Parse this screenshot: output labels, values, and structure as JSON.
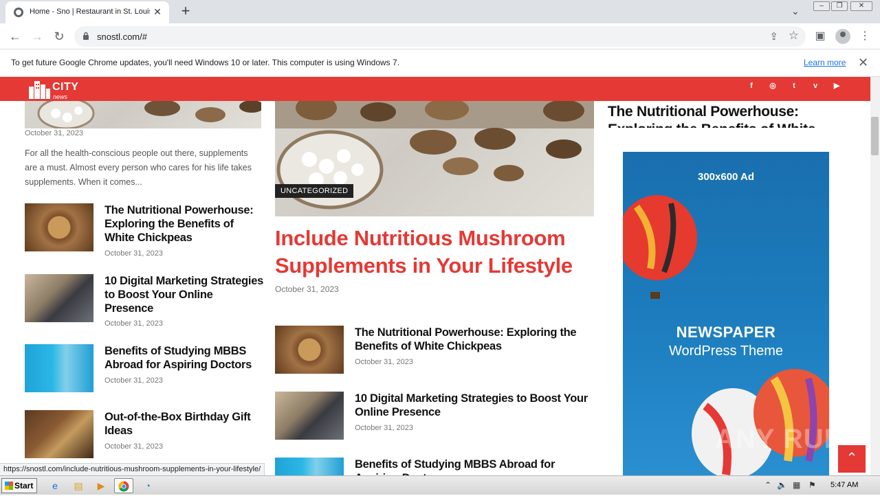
{
  "browser": {
    "tab_title": "Home - Sno | Restaurant in St. Louis",
    "tab_close": "✕",
    "new_tab": "+",
    "url": "snostl.com/#",
    "infobar_message": "To get future Google Chrome updates, you'll need Windows 10 or later. This computer is using Windows 7.",
    "infobar_link": "Learn more",
    "infobar_close": "✕",
    "status_url": "https://snostl.com/include-nutritious-mushroom-supplements-in-your-lifestyle/"
  },
  "site": {
    "logo_text": "CITY",
    "logo_sub": "news",
    "social": [
      {
        "icon": "facebook-icon",
        "glyph": "f"
      },
      {
        "icon": "instagram-icon",
        "glyph": "◎"
      },
      {
        "icon": "twitter-icon",
        "glyph": "t"
      },
      {
        "icon": "vimeo-icon",
        "glyph": "v"
      },
      {
        "icon": "youtube-icon",
        "glyph": "▶"
      }
    ],
    "accent_color": "#e53935"
  },
  "left_column": {
    "top_date": "October 31, 2023",
    "excerpt": "  For all the health-conscious people out there, supplements are a must. Almost every person who cares for his life takes supplements. When it comes...",
    "items": [
      {
        "title": "The Nutritional Powerhouse: Exploring the Benefits of White Chickpeas",
        "date": "October 31, 2023"
      },
      {
        "title": "10 Digital Marketing Strategies to Boost Your Online Presence",
        "date": "October 31, 2023"
      },
      {
        "title": "Benefits of Studying MBBS Abroad for Aspiring Doctors",
        "date": "October 31, 2023"
      },
      {
        "title": "Out-of-the-Box Birthday Gift Ideas",
        "date": "October 31, 2023"
      }
    ]
  },
  "main_column": {
    "category": "UNCATEGORIZED",
    "title": "Include Nutritious Mushroom Supplements in Your Lifestyle",
    "date": "October 31, 2023",
    "items": [
      {
        "title": "The Nutritional Powerhouse: Exploring the Benefits of White Chickpeas",
        "date": "October 31, 2023"
      },
      {
        "title": "10 Digital Marketing Strategies to Boost Your Online Presence",
        "date": "October 31, 2023"
      },
      {
        "title": "Benefits of Studying MBBS Abroad for Aspiring Doctors",
        "date": ""
      }
    ]
  },
  "right_column": {
    "title_partial": "The Nutritional Powerhouse: Exploring the Benefits of White",
    "ad_label": "300x600 Ad",
    "ad_brand": "NEWSPAPER",
    "ad_sub": "WordPress Theme"
  },
  "overlay": {
    "watermark": "ANY RUN",
    "back_to_top": "⌃"
  },
  "taskbar": {
    "start": "Start",
    "clock": "5:47 AM"
  }
}
